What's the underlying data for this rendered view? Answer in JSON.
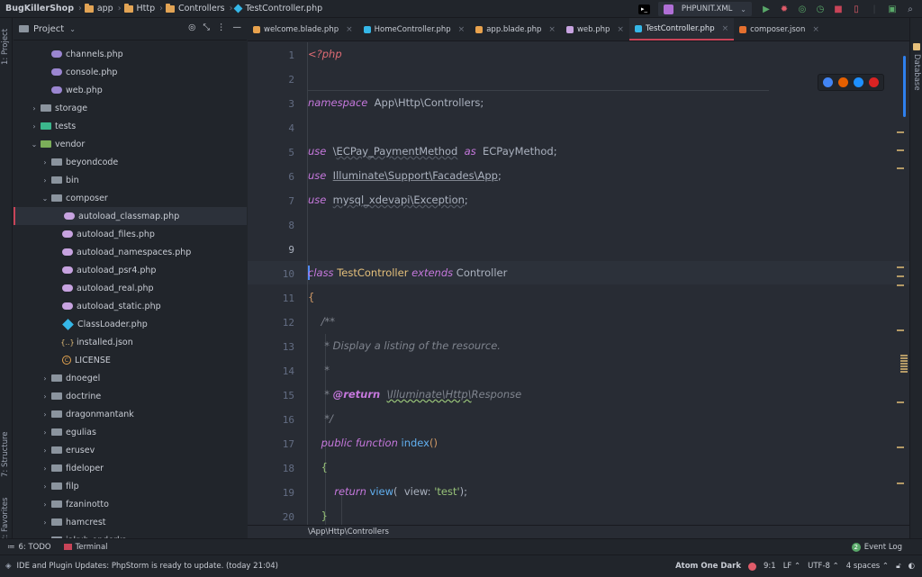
{
  "breadcrumb": [
    "BugKillerShop",
    "app",
    "Http",
    "Controllers",
    "TestController.php"
  ],
  "run_config": "PHPUNIT.XML",
  "left_strip": {
    "project": "1: Project",
    "structure": "7: Structure",
    "favorites": "2: Favorites"
  },
  "right_strip": {
    "database": "Database"
  },
  "project_panel": {
    "title": "Project",
    "tree": [
      {
        "label": "channels.php",
        "type": "php",
        "indent": 3
      },
      {
        "label": "console.php",
        "type": "php",
        "indent": 3
      },
      {
        "label": "web.php",
        "type": "php",
        "indent": 3
      },
      {
        "label": "storage",
        "type": "folder",
        "indent": 1,
        "arrow": "›"
      },
      {
        "label": "tests",
        "type": "folder-green",
        "indent": 1,
        "arrow": "›"
      },
      {
        "label": "vendor",
        "type": "folder-vendor",
        "indent": 1,
        "arrow": "⌄"
      },
      {
        "label": "beyondcode",
        "type": "folder",
        "indent": 2,
        "arrow": "›"
      },
      {
        "label": "bin",
        "type": "folder",
        "indent": 2,
        "arrow": "›"
      },
      {
        "label": "composer",
        "type": "folder",
        "indent": 2,
        "arrow": "⌄"
      },
      {
        "label": "autoload_classmap.php",
        "type": "php-pink",
        "indent": 4,
        "selected": true
      },
      {
        "label": "autoload_files.php",
        "type": "php-pink",
        "indent": 4
      },
      {
        "label": "autoload_namespaces.php",
        "type": "php-pink",
        "indent": 4
      },
      {
        "label": "autoload_psr4.php",
        "type": "php-pink",
        "indent": 4
      },
      {
        "label": "autoload_real.php",
        "type": "php-pink",
        "indent": 4
      },
      {
        "label": "autoload_static.php",
        "type": "php-pink",
        "indent": 4
      },
      {
        "label": "ClassLoader.php",
        "type": "class",
        "indent": 4
      },
      {
        "label": "installed.json",
        "type": "json",
        "indent": 4
      },
      {
        "label": "LICENSE",
        "type": "license",
        "indent": 4
      },
      {
        "label": "dnoegel",
        "type": "folder",
        "indent": 2,
        "arrow": "›"
      },
      {
        "label": "doctrine",
        "type": "folder",
        "indent": 2,
        "arrow": "›"
      },
      {
        "label": "dragonmantank",
        "type": "folder",
        "indent": 2,
        "arrow": "›"
      },
      {
        "label": "egulias",
        "type": "folder",
        "indent": 2,
        "arrow": "›"
      },
      {
        "label": "erusev",
        "type": "folder",
        "indent": 2,
        "arrow": "›"
      },
      {
        "label": "fideloper",
        "type": "folder",
        "indent": 2,
        "arrow": "›"
      },
      {
        "label": "filp",
        "type": "folder",
        "indent": 2,
        "arrow": "›"
      },
      {
        "label": "fzaninotto",
        "type": "folder",
        "indent": 2,
        "arrow": "›"
      },
      {
        "label": "hamcrest",
        "type": "folder",
        "indent": 2,
        "arrow": "›"
      },
      {
        "label": "jakub-onderka",
        "type": "folder",
        "indent": 2,
        "arrow": "›"
      }
    ]
  },
  "tabs": [
    {
      "label": "welcome.blade.php",
      "color": "#e8a24d"
    },
    {
      "label": "HomeController.php",
      "color": "#35b7e8"
    },
    {
      "label": "app.blade.php",
      "color": "#e8a24d"
    },
    {
      "label": "web.php",
      "color": "#c7a3e0"
    },
    {
      "label": "TestController.php",
      "color": "#35b7e8",
      "active": true
    },
    {
      "label": "composer.json",
      "color": "#e5702f"
    }
  ],
  "code": {
    "line_numbers": [
      "1",
      "2",
      "3",
      "4",
      "5",
      "6",
      "7",
      "8",
      "9",
      "10",
      "11",
      "12",
      "13",
      "14",
      "15",
      "16",
      "17",
      "18",
      "19",
      "20"
    ],
    "current_line": 9,
    "lines": [
      [
        [
          "tag",
          "<?php"
        ]
      ],
      [],
      [
        [
          "kw",
          "namespace"
        ],
        [
          "",
          "  App\\Http\\Controllers;"
        ]
      ],
      [],
      [
        [
          "kw",
          "use"
        ],
        [
          "",
          "  \\"
        ],
        [
          "u",
          "ECPay_PaymentMethod"
        ],
        [
          "kw",
          "  as  "
        ],
        [
          "",
          "ECPayMethod;"
        ]
      ],
      [
        [
          "kw",
          "use"
        ],
        [
          "",
          "  "
        ],
        [
          "u2",
          "Illuminate\\Support\\Facades\\App"
        ],
        [
          "",
          ";"
        ]
      ],
      [
        [
          "kw",
          "use"
        ],
        [
          "",
          "  "
        ],
        [
          "u",
          "mysql_xdevapi\\Exception"
        ],
        [
          "",
          ";"
        ]
      ],
      [],
      [],
      [
        [
          "kw",
          "class"
        ],
        [
          "cls",
          " TestController "
        ],
        [
          "kw",
          "extends"
        ],
        [
          "",
          " Controller"
        ]
      ],
      [
        [
          "brk",
          "{"
        ]
      ],
      [
        [
          "cm",
          "    /**"
        ]
      ],
      [
        [
          "cm",
          "     * Display a listing of the resource."
        ]
      ],
      [
        [
          "cm",
          "     *"
        ]
      ],
      [
        [
          "cm",
          "     * "
        ],
        [
          "cmb",
          "@return"
        ],
        [
          "cm",
          "  "
        ],
        [
          "cmu",
          "\\Illuminate\\Http\\"
        ],
        [
          "cm",
          "Response"
        ]
      ],
      [
        [
          "cm",
          "     */"
        ]
      ],
      [
        [
          "",
          "    "
        ],
        [
          "kw",
          "public function "
        ],
        [
          "fn",
          "index"
        ],
        [
          "brk",
          "()"
        ]
      ],
      [
        [
          "",
          "    "
        ],
        [
          "str",
          "{"
        ]
      ],
      [
        [
          "",
          "        "
        ],
        [
          "kw",
          "return "
        ],
        [
          "fn",
          "view"
        ],
        [
          "",
          "(  view: "
        ],
        [
          "str",
          "'test'"
        ],
        [
          "",
          ");"
        ]
      ],
      [
        [
          "",
          "    "
        ],
        [
          "str",
          "}"
        ]
      ]
    ]
  },
  "editor_breadcrumb": "\\App\\Http\\Controllers",
  "tool_windows": {
    "todo": "6: TODO",
    "terminal": "Terminal",
    "event_log": "Event Log",
    "event_count": "2"
  },
  "status": {
    "message": "IDE and Plugin Updates: PhpStorm is ready to update. (today 21:04)",
    "theme": "Atom One Dark",
    "position": "9:1",
    "line_sep": "LF ⌃",
    "encoding": "UTF-8 ⌃",
    "indent": "4 spaces ⌃"
  },
  "colors": {
    "accent": "#c84458",
    "bg": "#282c34",
    "panel": "#21252b"
  }
}
